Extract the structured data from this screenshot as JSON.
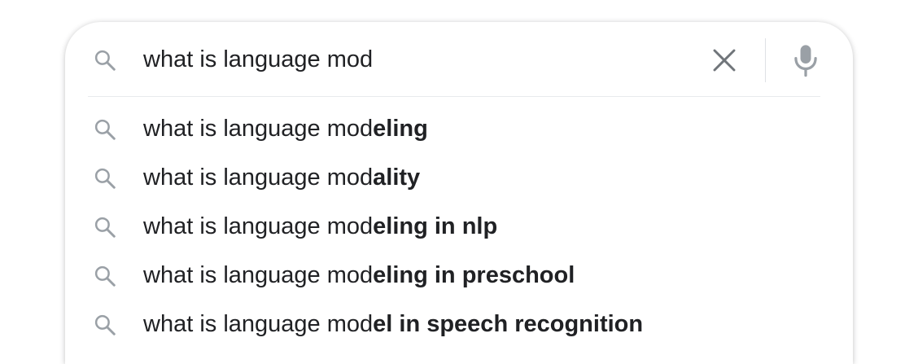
{
  "search": {
    "query": "what is language mod",
    "icon": "search-icon",
    "clear_icon": "close-icon",
    "mic_icon": "microphone-icon"
  },
  "suggestions": [
    {
      "prefix": "what is language mod",
      "completion": "eling"
    },
    {
      "prefix": "what is language mod",
      "completion": "ality"
    },
    {
      "prefix": "what is language mod",
      "completion": "eling in nlp"
    },
    {
      "prefix": "what is language mod",
      "completion": "eling in preschool"
    },
    {
      "prefix": "what is language mod",
      "completion": "el in speech recognition"
    }
  ],
  "colors": {
    "text": "#202124",
    "icon": "#9aa0a6",
    "clear": "#70757a",
    "divider": "#dfe1e5"
  }
}
